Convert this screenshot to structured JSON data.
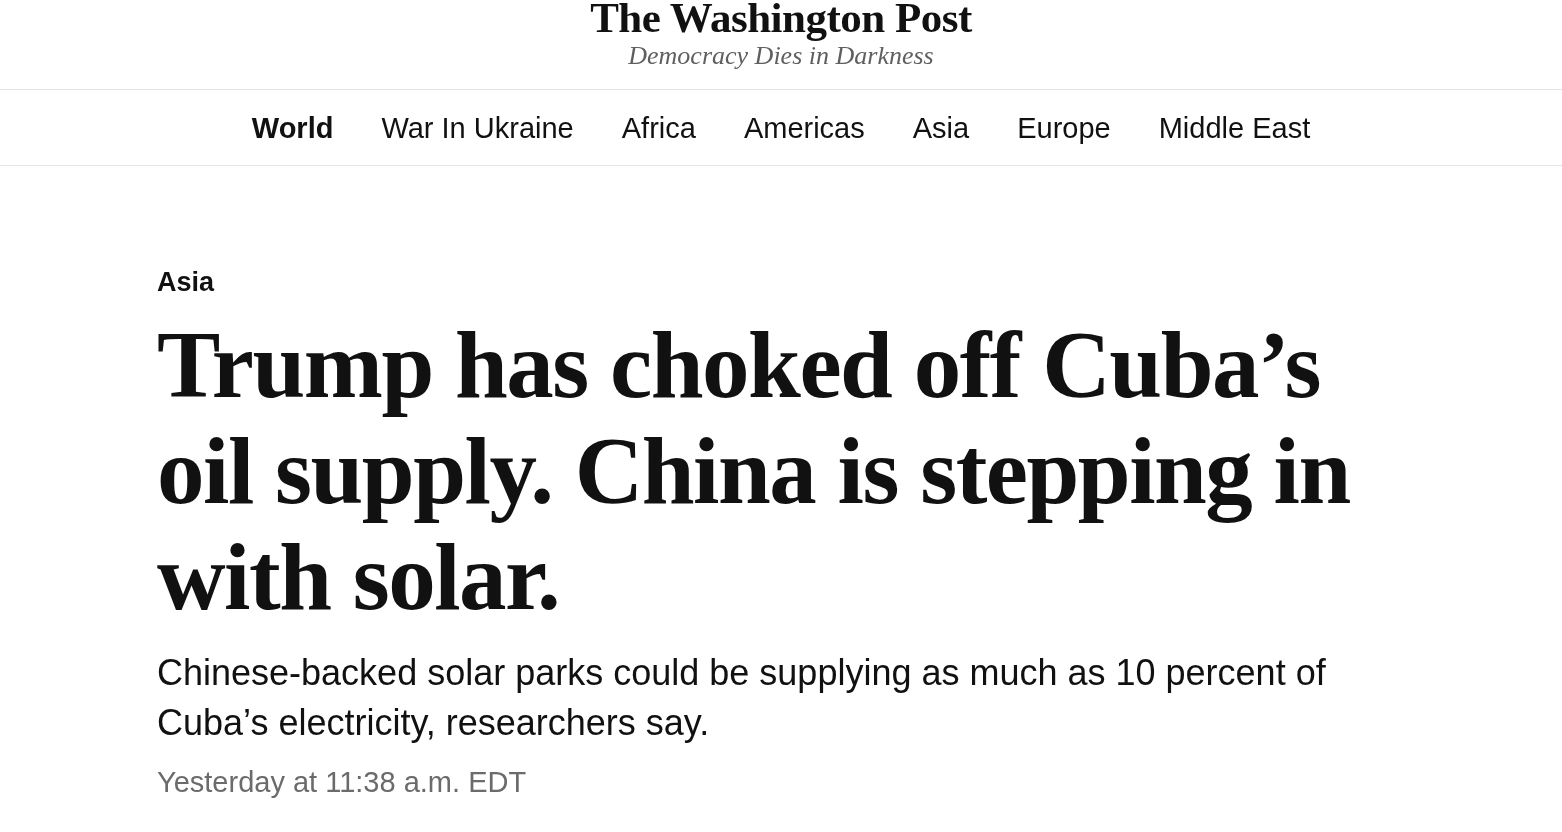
{
  "masthead": {
    "logo": "The Washington Post",
    "tagline": "Democracy Dies in Darkness"
  },
  "nav": [
    {
      "label": "World",
      "selected": true
    },
    {
      "label": "War In Ukraine",
      "selected": false
    },
    {
      "label": "Africa",
      "selected": false
    },
    {
      "label": "Americas",
      "selected": false
    },
    {
      "label": "Asia",
      "selected": false
    },
    {
      "label": "Europe",
      "selected": false
    },
    {
      "label": "Middle East",
      "selected": false
    }
  ],
  "article": {
    "kicker": "Asia",
    "headline": "Trump has choked off Cuba’s oil supply. China is stepping in with solar.",
    "dek": "Chinese-backed solar parks could be supplying as much as 10 percent of Cuba’s electricity, researchers say.",
    "timestamp": "Yesterday at 11:38 a.m. EDT"
  }
}
